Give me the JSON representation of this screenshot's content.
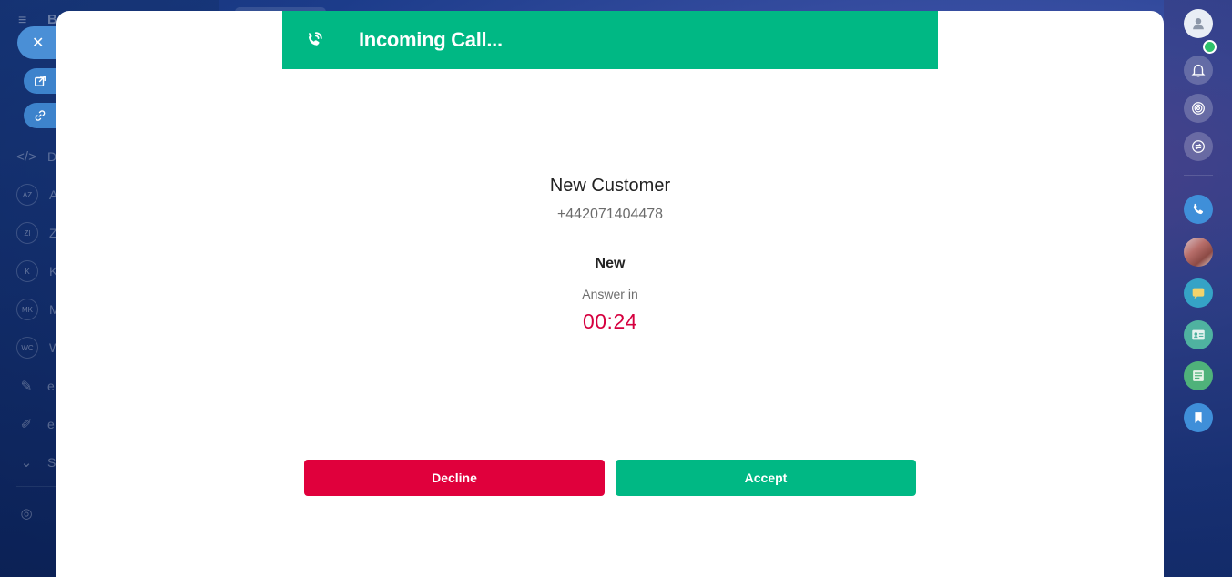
{
  "call": {
    "header_title": "Incoming Call...",
    "caller_name": "New Customer",
    "caller_phone": "+442071404478",
    "status": "New",
    "answer_label": "Answer in",
    "countdown": "00:24",
    "decline_label": "Decline",
    "accept_label": "Accept"
  },
  "background_sidebar": {
    "items": [
      {
        "badge": "",
        "label": "D",
        "icon": "code-icon"
      },
      {
        "badge": "AZ",
        "label": "A"
      },
      {
        "badge": "ZI",
        "label": "Z"
      },
      {
        "badge": "K",
        "label": "K"
      },
      {
        "badge": "MK",
        "label": "M"
      },
      {
        "badge": "WC",
        "label": "W"
      },
      {
        "badge": "",
        "label": "e",
        "icon": "document-edit-icon"
      },
      {
        "badge": "",
        "label": "e",
        "icon": "pencil-icon"
      },
      {
        "badge": "",
        "label": "S",
        "icon": "chevron-down-icon"
      }
    ],
    "menu_letter": "B"
  },
  "colors": {
    "header_green": "#00b884",
    "accept_green": "#00b884",
    "decline_red": "#e0003c",
    "countdown_red": "#d6003f"
  },
  "icons": {
    "header": "phone-ringing-icon",
    "side_close": "close-icon",
    "side_open": "external-link-icon",
    "side_link": "link-icon",
    "rail": [
      "user-profile-icon",
      "bell-icon",
      "target-icon",
      "sync-chat-icon",
      "phone-icon",
      "avatar",
      "chat-icon",
      "contact-card-icon",
      "newspaper-icon",
      "bookmark-icon"
    ]
  }
}
